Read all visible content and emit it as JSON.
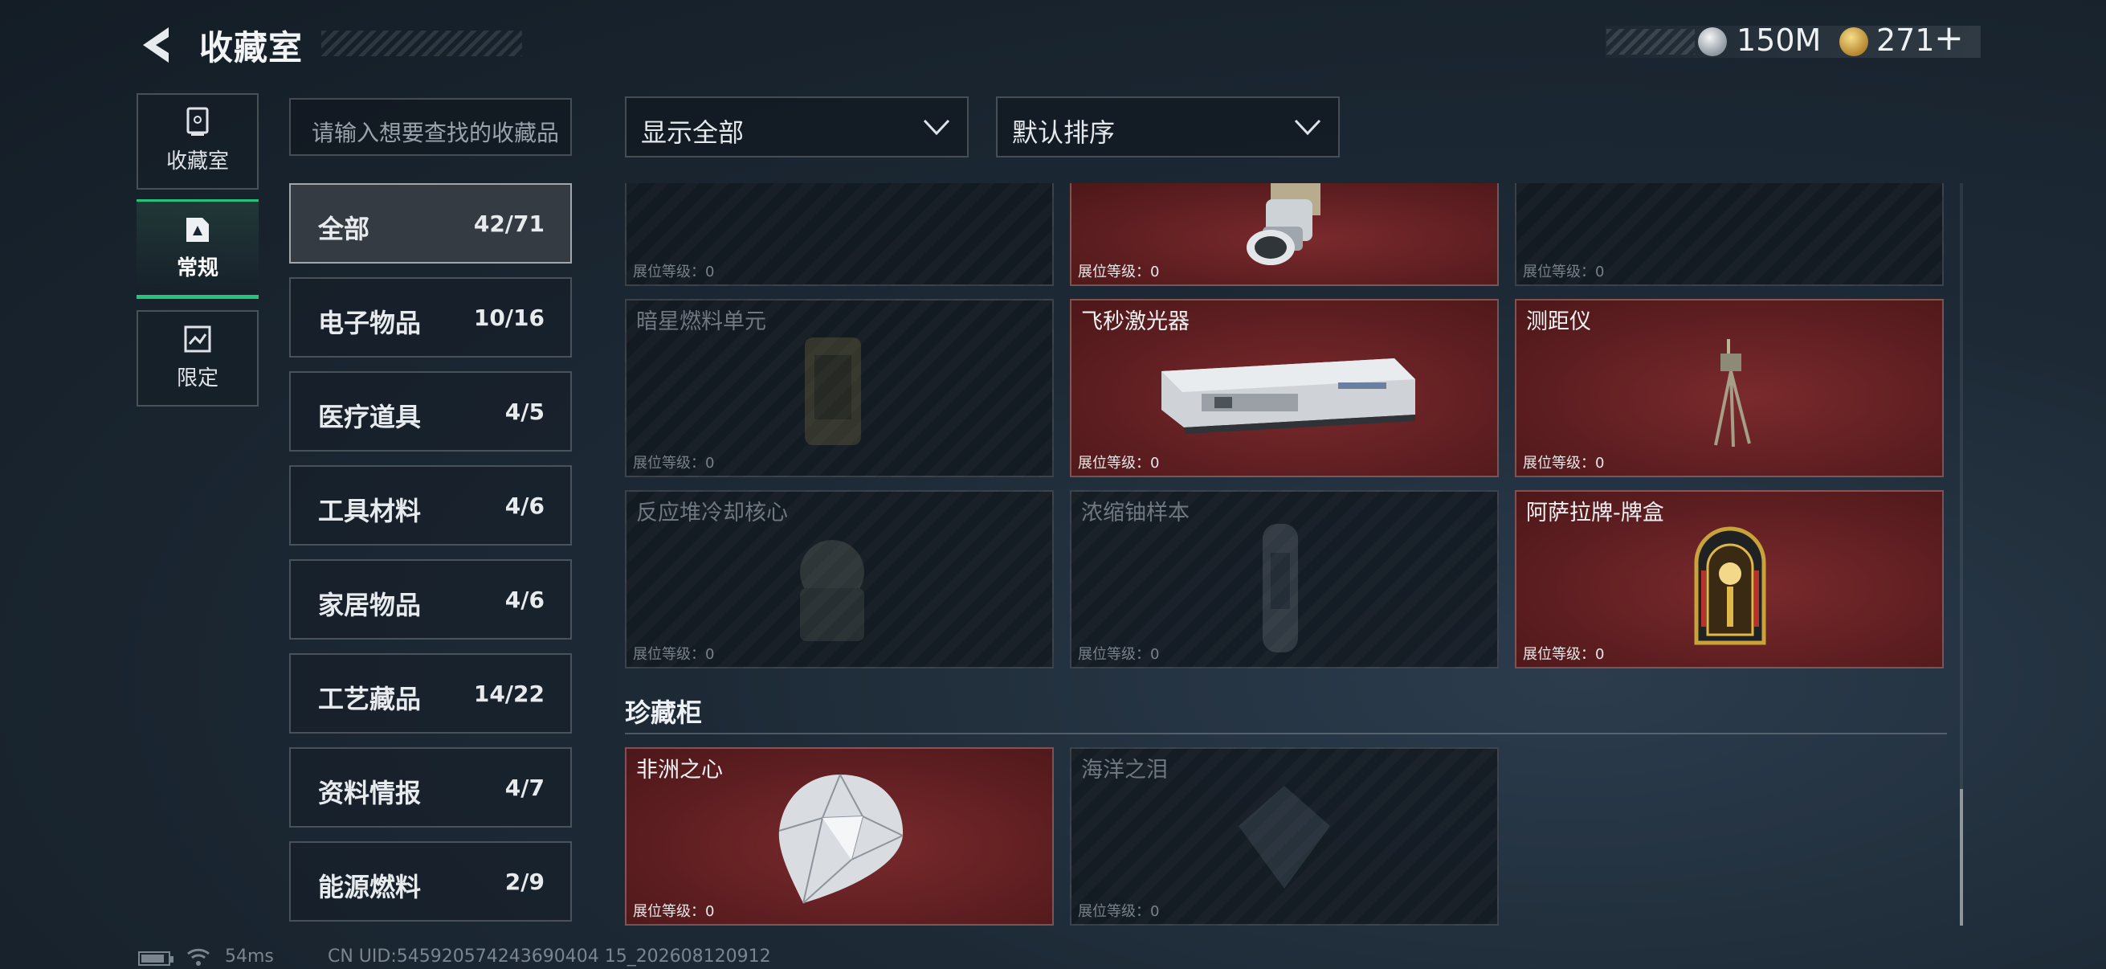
{
  "header": {
    "title": "收藏室",
    "currency_silver": "150M",
    "currency_gold": "271"
  },
  "side_tabs": [
    {
      "label": "收藏室",
      "icon": "collection-room-icon",
      "active": false
    },
    {
      "label": "常规",
      "icon": "regular-icon",
      "active": true
    },
    {
      "label": "限定",
      "icon": "limited-icon",
      "active": false
    }
  ],
  "search": {
    "placeholder": "请输入想要查找的收藏品"
  },
  "categories": [
    {
      "label": "全部",
      "count": "42/71",
      "active": true
    },
    {
      "label": "电子物品",
      "count": "10/16"
    },
    {
      "label": "医疗道具",
      "count": "4/5"
    },
    {
      "label": "工具材料",
      "count": "4/6"
    },
    {
      "label": "家居物品",
      "count": "4/6"
    },
    {
      "label": "工艺藏品",
      "count": "14/22"
    },
    {
      "label": "资料情报",
      "count": "4/7"
    },
    {
      "label": "能源燃料",
      "count": "2/9"
    }
  ],
  "filters": {
    "show": "显示全部",
    "sort": "默认排序"
  },
  "level_label": "展位等级：0",
  "items": [
    {
      "name": "",
      "owned": false,
      "icon": "item-icon"
    },
    {
      "name": "",
      "owned": true,
      "icon": "lens-device-icon"
    },
    {
      "name": "",
      "owned": false,
      "icon": "item-icon"
    },
    {
      "name": "暗星燃料单元",
      "owned": false,
      "icon": "fuel-cell-icon"
    },
    {
      "name": "飞秒激光器",
      "owned": true,
      "icon": "laser-device-icon"
    },
    {
      "name": "测距仪",
      "owned": true,
      "icon": "rangefinder-tripod-icon"
    },
    {
      "name": "反应堆冷却核心",
      "owned": false,
      "icon": "reactor-core-icon"
    },
    {
      "name": "浓缩铀样本",
      "owned": false,
      "icon": "uranium-sample-icon"
    },
    {
      "name": "阿萨拉牌-牌盒",
      "owned": true,
      "icon": "card-box-icon"
    }
  ],
  "treasure_section": {
    "title": "珍藏柜",
    "items": [
      {
        "name": "非洲之心",
        "owned": true,
        "icon": "diamond-icon"
      },
      {
        "name": "海洋之泪",
        "owned": false,
        "icon": "gem-icon"
      }
    ]
  },
  "footer": {
    "ping": "54ms",
    "uid": "CN UID:545920574243690404 15_202608120912"
  }
}
